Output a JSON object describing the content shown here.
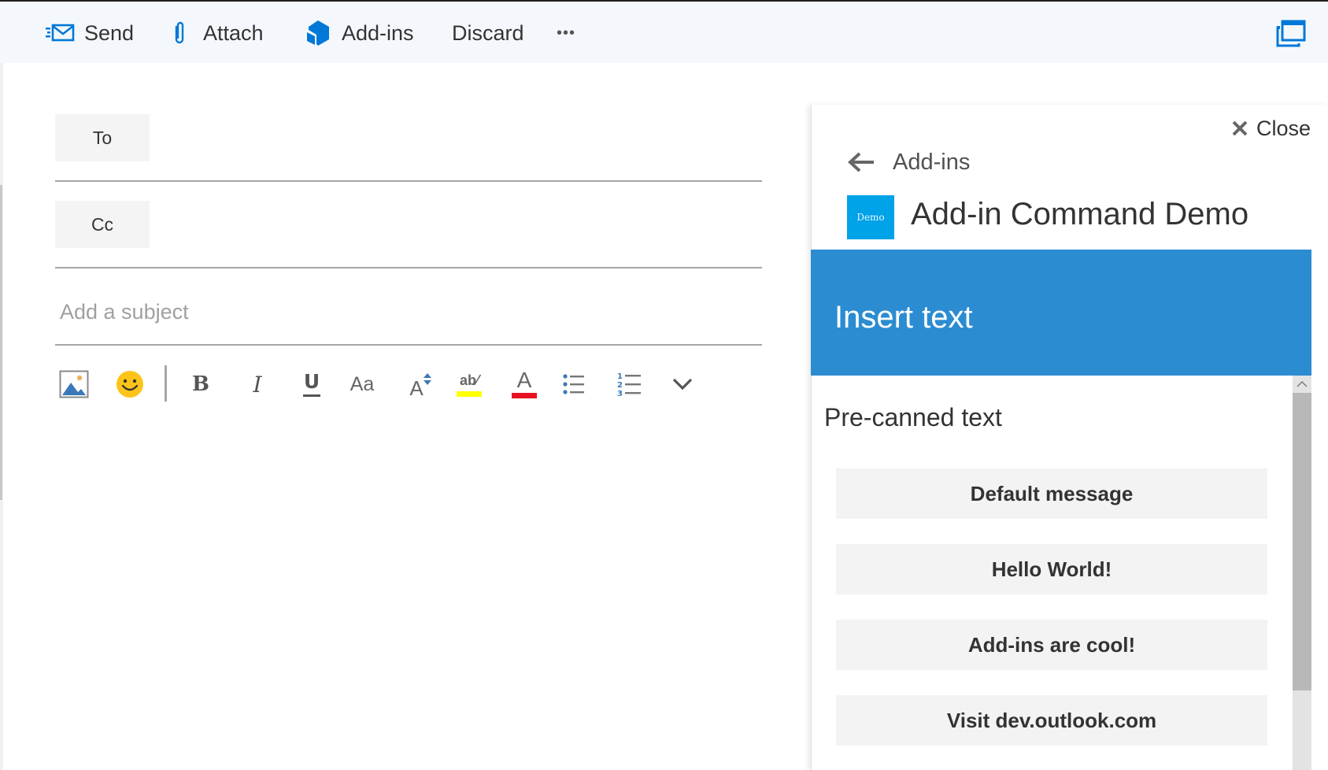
{
  "toolbar": {
    "send_label": "Send",
    "attach_label": "Attach",
    "addins_label": "Add-ins",
    "discard_label": "Discard",
    "more_label": "•••",
    "icons": {
      "send": "send-mail-icon",
      "attach": "paperclip-icon",
      "addins": "addins-cube-icon",
      "popout": "popout-window-icon"
    },
    "accent_color": "#0078d7"
  },
  "compose": {
    "to_label": "To",
    "cc_label": "Cc",
    "to_value": "",
    "cc_value": "",
    "subject_placeholder": "Add a subject",
    "subject_value": ""
  },
  "format_toolbar": {
    "items": [
      {
        "name": "insert-picture",
        "glyph": ""
      },
      {
        "name": "emoji",
        "glyph": ""
      },
      {
        "name": "bold",
        "glyph": "B"
      },
      {
        "name": "italic",
        "glyph": "I"
      },
      {
        "name": "underline",
        "glyph": "U"
      },
      {
        "name": "font",
        "glyph": "Aa"
      },
      {
        "name": "font-size",
        "glyph": "A"
      },
      {
        "name": "highlight",
        "glyph": "ab"
      },
      {
        "name": "font-color",
        "glyph": "A"
      },
      {
        "name": "bullets",
        "glyph": ""
      },
      {
        "name": "numbering",
        "glyph": ""
      },
      {
        "name": "more-options",
        "glyph": ""
      }
    ],
    "highlight_color": "#ffff00",
    "font_color": "#e81123"
  },
  "addin_pane": {
    "close_label": "Close",
    "back_label": "Add-ins",
    "logo_text": "Demo",
    "addin_name": "Add-in Command Demo",
    "header_title": "Insert text",
    "header_color": "#2b8cd2",
    "section_title": "Pre-canned text",
    "buttons": [
      {
        "label": "Default message"
      },
      {
        "label": "Hello World!"
      },
      {
        "label": "Add-ins are cool!"
      },
      {
        "label": "Visit dev.outlook.com"
      }
    ]
  }
}
